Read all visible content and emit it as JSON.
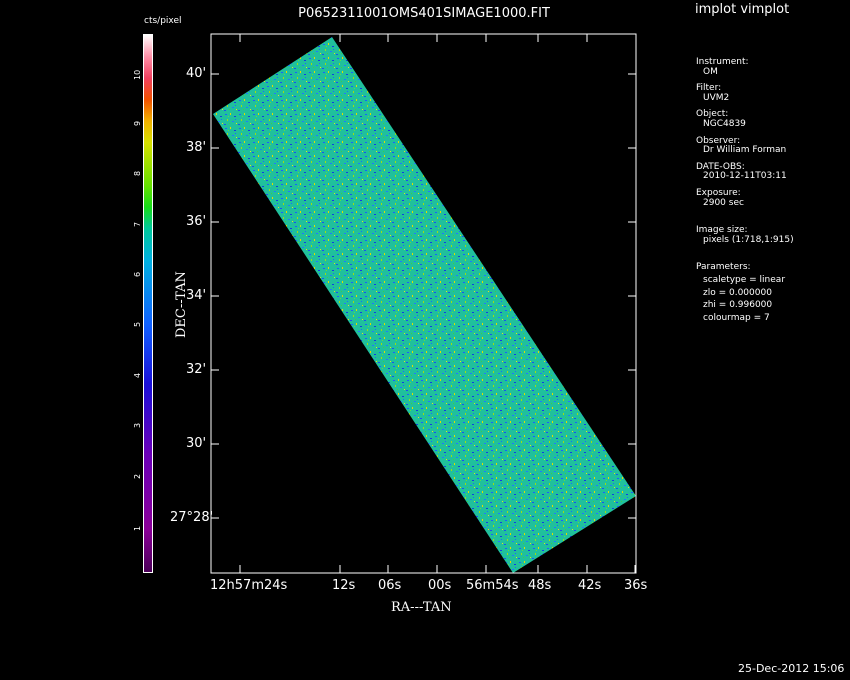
{
  "plot": {
    "title": "P0652311001OMS401SIMAGE1000.FIT",
    "x_axis_label": "RA---TAN",
    "y_axis_label": "DEC--TAN",
    "y_ticks": [
      "40'",
      "38'",
      "36'",
      "34'",
      "32'",
      "30'",
      "27°28'"
    ],
    "x_ticks": [
      "12h57m24s",
      "12s",
      "06s",
      "00s",
      "56m54s",
      "48s",
      "42s",
      "36s"
    ],
    "colors": {
      "image_base": "#1ec8a0",
      "image_accent_blue": "#1860ff",
      "image_accent_yellow": "#e0e000"
    }
  },
  "colorbar": {
    "unit": "cts/pixel",
    "ticks": [
      "1",
      "2",
      "3",
      "4",
      "5",
      "6",
      "7",
      "8",
      "9",
      "10"
    ]
  },
  "app_title": "implot vimplot",
  "info": {
    "instrument_label": "Instrument:",
    "instrument": "OM",
    "filter_label": "Filter:",
    "filter": "UVM2",
    "object_label": "Object:",
    "object": "NGC4839",
    "observer_label": "Observer:",
    "observer": "Dr William Forman",
    "date_label": "DATE-OBS:",
    "date": "2010-12-11T03:11",
    "exposure_label": "Exposure:",
    "exposure": "2900 sec",
    "image_size_label": "Image size:",
    "image_size": "pixels (1:718,1:915)",
    "parameters_label": "Parameters:",
    "scaletype": "scaletype = linear",
    "zlo": "zlo = 0.000000",
    "zhi": "zhi = 0.996000",
    "colourmap": "colourmap =   7"
  },
  "timestamp": "25-Dec-2012 15:06"
}
